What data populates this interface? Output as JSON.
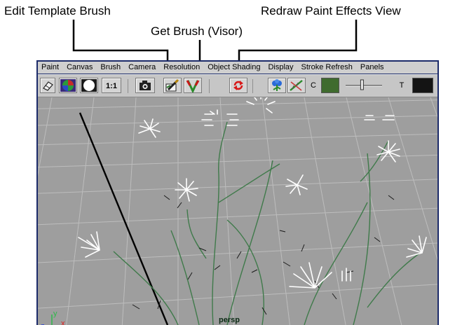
{
  "callouts": {
    "edit_template_brush": "Edit Template Brush",
    "get_brush": "Get Brush (Visor)",
    "redraw_view": "Redraw Paint Effects View"
  },
  "menu": [
    "Paint",
    "Canvas",
    "Brush",
    "Camera",
    "Resolution",
    "Object Shading",
    "Display",
    "Stroke Refresh",
    "Panels"
  ],
  "toolbar": {
    "eraser_icon": "eraser-icon",
    "sphere_icon": "shaded-sphere-icon",
    "circle_icon": "white-circle-icon",
    "ratio_label": "1:1",
    "camera_icon": "camera-icon",
    "edit_brush_icon": "edit-template-brush-icon",
    "get_brush_icon": "get-brush-icon",
    "redraw_icon": "redraw-icon",
    "c_label": "C",
    "t_label": "T",
    "color_swatch": "#3f6b2e",
    "transparency_swatch": "#141414",
    "slider_value": 0.45
  },
  "viewport": {
    "label": "persp",
    "axis": {
      "x": "x",
      "y": "y",
      "z": "z"
    }
  },
  "colors": {
    "window_frame": "#1c2b6a",
    "viewport_bg": "#9e9e9e",
    "stems": "#3f7a4a",
    "redraw_icon": "#d81818"
  }
}
